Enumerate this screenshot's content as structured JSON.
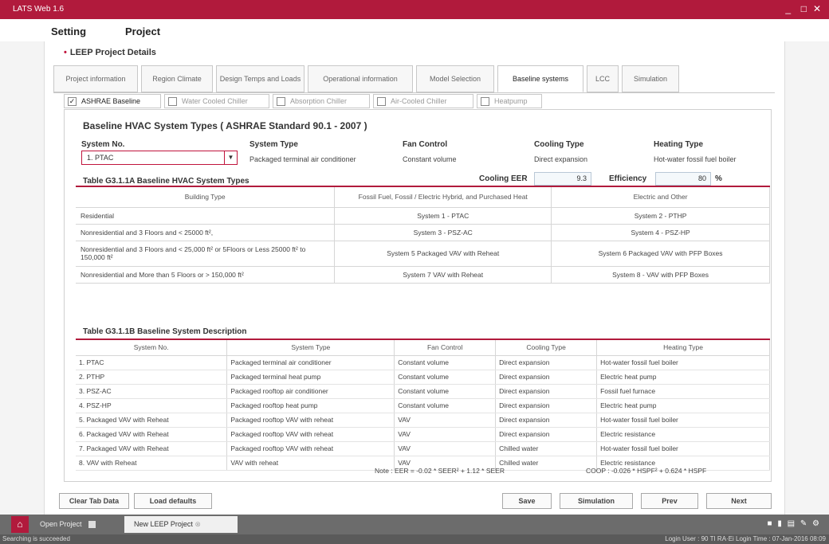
{
  "app": {
    "title": "LATS Web 1.6",
    "minimize": "_",
    "restore": "□",
    "close": "✕"
  },
  "menu": {
    "setting": "Setting",
    "project": "Project"
  },
  "section_title": "LEEP Project Details",
  "tabs": [
    {
      "label": "Project information"
    },
    {
      "label": "Region Climate"
    },
    {
      "label": "Design Temps and Loads"
    },
    {
      "label": "Operational information"
    },
    {
      "label": "Model Selection"
    },
    {
      "label": "Baseline systems"
    },
    {
      "label": "LCC"
    },
    {
      "label": "Simulation"
    }
  ],
  "subtabs": [
    {
      "label": "ASHRAE Baseline",
      "checked": true
    },
    {
      "label": "Water Cooled Chiller",
      "checked": false
    },
    {
      "label": "Absorption Chiller",
      "checked": false
    },
    {
      "label": "Air-Cooled Chiller",
      "checked": false
    },
    {
      "label": "Heatpump",
      "checked": false
    }
  ],
  "hvac": {
    "title": "Baseline HVAC System Types ( ASHRAE Standard 90.1 - 2007 )",
    "system_no_label": "System No.",
    "system_no_value": "1. PTAC",
    "system_type_label": "System Type",
    "system_type_value": "Packaged terminal air conditioner",
    "fan_control_label": "Fan Control",
    "fan_control_value": "Constant volume",
    "cooling_type_label": "Cooling Type",
    "cooling_type_value": "Direct expansion",
    "heating_type_label": "Heating Type",
    "heating_type_value": "Hot-water fossil fuel boiler",
    "cooling_eer_label": "Cooling EER",
    "cooling_eer_value": "9.3",
    "efficiency_label": "Efficiency",
    "efficiency_value": "80",
    "efficiency_unit": "%"
  },
  "table_a": {
    "title": "Table G3.1.1A Baseline HVAC System Types",
    "headers": [
      "Building Type",
      "Fossil Fuel, Fossil / Electric Hybrid, and Purchased Heat",
      "Electric and Other"
    ],
    "rows": [
      [
        "Residential",
        "System 1 - PTAC",
        "System 2 - PTHP"
      ],
      [
        "Nonresidential and 3 Floors and < 25000 ft²,",
        "System 3 - PSZ-AC",
        "System 4 - PSZ-HP"
      ],
      [
        "Nonresidential and 3 Floors and < 25,000 ft² or 5Floors or Less 25000 ft² to 150,000 ft²",
        "System 5 Packaged VAV with Reheat",
        "System 6 Packaged VAV with PFP Boxes"
      ],
      [
        "Nonresidential and More than 5 Floors or > 150,000 ft²",
        "System 7  VAV with Reheat",
        "System 8 - VAV with PFP Boxes"
      ]
    ]
  },
  "table_b": {
    "title": "Table G3.1.1B Baseline System Description",
    "headers": [
      "System No.",
      "System Type",
      "Fan Control",
      "Cooling Type",
      "Heating Type"
    ],
    "rows": [
      [
        "1. PTAC",
        "Packaged terminal air conditioner",
        "Constant volume",
        "Direct expansion",
        "Hot-water fossil fuel boiler"
      ],
      [
        "2. PTHP",
        "Packaged terminal heat pump",
        "Constant volume",
        "Direct expansion",
        "Electric heat pump"
      ],
      [
        "3. PSZ-AC",
        "Packaged rooftop air conditioner",
        "Constant volume",
        "Direct expansion",
        "Fossil fuel furnace"
      ],
      [
        "4. PSZ-HP",
        "Packaged rooftop heat pump",
        "Constant volume",
        "Direct expansion",
        "Electric heat pump"
      ],
      [
        "5. Packaged VAV with Reheat",
        "Packaged rooftop VAV with reheat",
        "VAV",
        "Direct expansion",
        "Hot-water fossil fuel boiler"
      ],
      [
        "6. Packaged VAV with Reheat",
        "Packaged rooftop VAV with reheat",
        "VAV",
        "Direct expansion",
        "Electric resistance"
      ],
      [
        "7. Packaged VAV with Reheat",
        "Packaged rooftop VAV with reheat",
        "VAV",
        "Chilled water",
        "Hot-water fossil fuel boiler"
      ],
      [
        "8. VAV with Reheat",
        "VAV with reheat",
        "VAV",
        "Chilled water",
        "Electric resistance"
      ]
    ]
  },
  "note": {
    "eer": "Note : EER = -0.02 * SEER² + 1.12 * SEER",
    "cop": "COOP : -0.026 * HSPF² + 0.624 * HSPF"
  },
  "buttons": {
    "clear_tab_data": "Clear Tab Data",
    "load_defaults": "Load defaults",
    "save": "Save",
    "simulation": "Simulation",
    "prev": "Prev",
    "next": "Next"
  },
  "taskbar": {
    "open_project": "Open Project",
    "current_project": "New LEEP Project",
    "tray": "■ ▮ ▤ ✎ ⚙"
  },
  "status": {
    "left": "Searching is succeeded",
    "right": "Login User : 90 TI RA·Ei Login Time : 07-Jan-2016 08:09"
  }
}
